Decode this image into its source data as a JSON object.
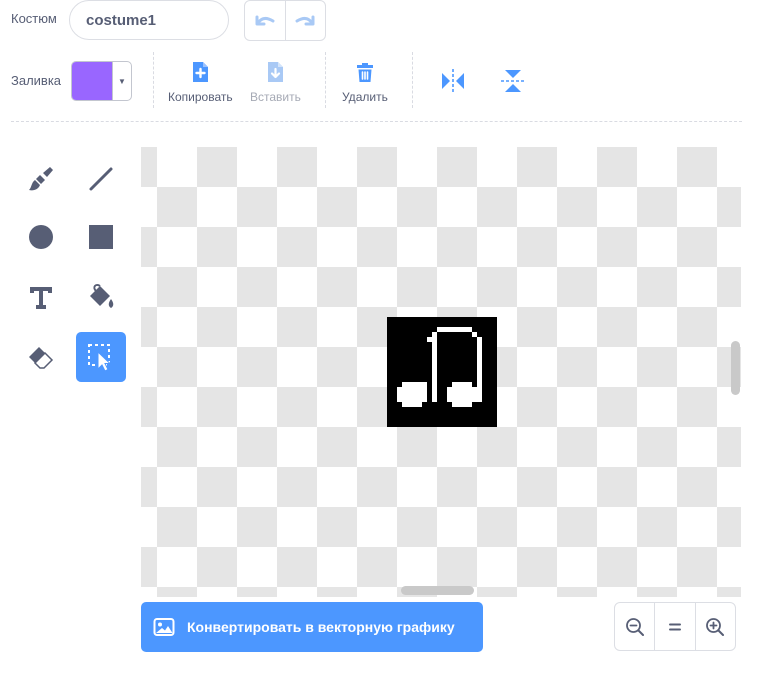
{
  "costume": {
    "label": "Костюм",
    "name_value": "costume1"
  },
  "fill": {
    "label": "Заливка",
    "color": "#9966ff"
  },
  "actions": {
    "copy_label": "Копировать",
    "paste_label": "Вставить",
    "delete_label": "Удалить"
  },
  "tools": [
    {
      "name": "brush-tool",
      "icon": "brush-icon",
      "active": false
    },
    {
      "name": "line-tool",
      "icon": "line-icon",
      "active": false
    },
    {
      "name": "circle-tool",
      "icon": "circle-icon",
      "active": false
    },
    {
      "name": "rectangle-tool",
      "icon": "rectangle-icon",
      "active": false
    },
    {
      "name": "text-tool",
      "icon": "text-icon",
      "active": false
    },
    {
      "name": "fill-tool",
      "icon": "fill-bucket-icon",
      "active": false
    },
    {
      "name": "eraser-tool",
      "icon": "eraser-icon",
      "active": false
    },
    {
      "name": "select-tool",
      "icon": "select-icon",
      "active": true
    }
  ],
  "convert_button_label": "Конвертировать в векторную графику",
  "colors": {
    "accent": "#4c97ff",
    "text": "#575e75",
    "sprite": "#000000"
  }
}
